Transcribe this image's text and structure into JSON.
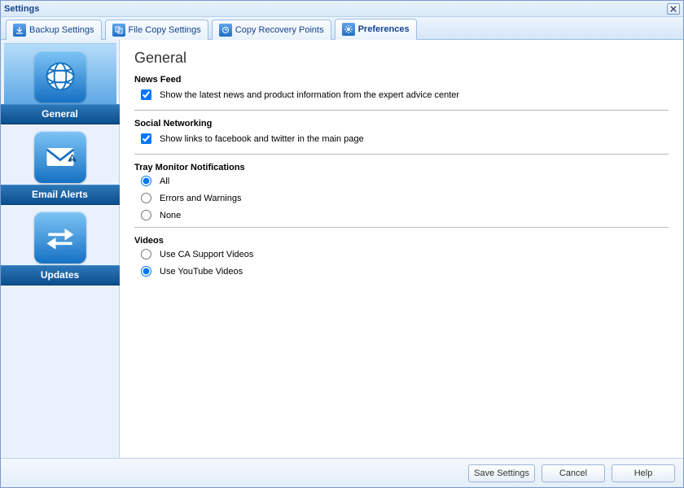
{
  "window": {
    "title": "Settings"
  },
  "tabs": [
    {
      "label": "Backup Settings",
      "active": false
    },
    {
      "label": "File Copy Settings",
      "active": false
    },
    {
      "label": "Copy Recovery Points",
      "active": false
    },
    {
      "label": "Preferences",
      "active": true
    }
  ],
  "sidebar": {
    "items": [
      {
        "label": "General",
        "active": true,
        "icon": "globe-icon"
      },
      {
        "label": "Email Alerts",
        "active": false,
        "icon": "mail-alert-icon"
      },
      {
        "label": "Updates",
        "active": false,
        "icon": "arrows-icon"
      }
    ]
  },
  "main": {
    "heading": "General",
    "newsfeed": {
      "title": "News Feed",
      "show_label": "Show the latest news and product information from the expert advice center",
      "checked": true
    },
    "social": {
      "title": "Social Networking",
      "show_label": "Show links to facebook and twitter in the main page",
      "checked": true
    },
    "tray": {
      "title": "Tray Monitor Notifications",
      "options": [
        {
          "label": "All",
          "selected": true
        },
        {
          "label": "Errors and Warnings",
          "selected": false
        },
        {
          "label": "None",
          "selected": false
        }
      ]
    },
    "videos": {
      "title": "Videos",
      "options": [
        {
          "label": "Use CA Support Videos",
          "selected": false
        },
        {
          "label": "Use YouTube Videos",
          "selected": true
        }
      ]
    }
  },
  "footer": {
    "save": "Save Settings",
    "cancel": "Cancel",
    "help": "Help"
  }
}
